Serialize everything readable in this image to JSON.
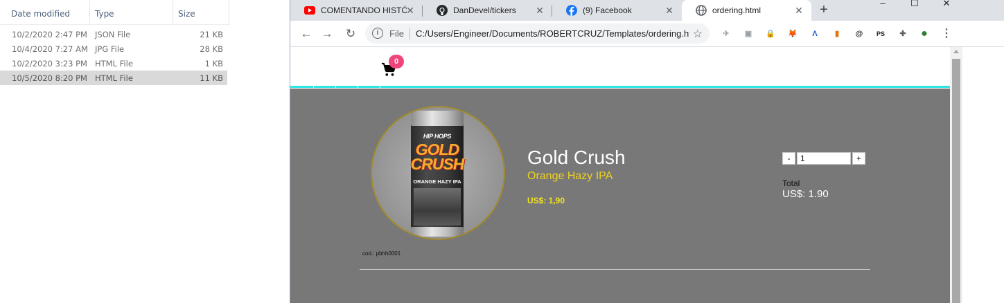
{
  "explorer": {
    "columns": {
      "date": "Date modified",
      "type": "Type",
      "size": "Size"
    },
    "rows": [
      {
        "date": "10/2/2020 2:47 PM",
        "type": "JSON File",
        "size": "21 KB"
      },
      {
        "date": "10/4/2020 7:27 AM",
        "type": "JPG File",
        "size": "28 KB"
      },
      {
        "date": "10/2/2020 3:23 PM",
        "type": "HTML File",
        "size": "1 KB"
      },
      {
        "date": "10/5/2020 8:20 PM",
        "type": "HTML File",
        "size": "11 KB",
        "selected": true
      }
    ]
  },
  "browser": {
    "tabs": [
      {
        "label": "COMENTANDO HISTÓI",
        "icon": "youtube-icon",
        "color": "#ff0000"
      },
      {
        "label": "DanDevel/tickers",
        "icon": "github-icon"
      },
      {
        "label": "(9) Facebook",
        "icon": "facebook-icon",
        "color": "#1877f2"
      },
      {
        "label": "ordering.html",
        "icon": "globe-icon",
        "active": true
      }
    ],
    "window_controls": {
      "minimize": "–",
      "maximize": "☐",
      "close": "✕"
    },
    "new_tab": "+",
    "address": {
      "scheme_label": "File",
      "url": "C:/Users/Engineer/Documents/ROBERTCRUZ/Templates/ordering.html"
    },
    "extensions": [
      {
        "icon": "pin-icon",
        "glyph": "✈"
      },
      {
        "icon": "page-icon",
        "glyph": "▣"
      },
      {
        "icon": "lock-extension-icon",
        "glyph": "🔒"
      },
      {
        "icon": "metamask-icon",
        "glyph": "🦊"
      },
      {
        "icon": "a-logo-icon",
        "glyph": "Λ"
      },
      {
        "icon": "bar-chart-icon",
        "glyph": "▮"
      },
      {
        "icon": "at-icon",
        "glyph": "@"
      },
      {
        "icon": "ps-icon",
        "glyph": "PS"
      },
      {
        "icon": "puzzle-icon",
        "glyph": "✚"
      },
      {
        "icon": "profile-avatar-icon",
        "glyph": "●"
      }
    ],
    "menu_glyph": "⋮"
  },
  "page": {
    "cart_count": "0",
    "product": {
      "name": "Gold Crush",
      "style": "Orange Hazy IPA",
      "price": "US$: 1,90",
      "code": "cod.: pbhh0001",
      "can_brand": "HIP HOPS",
      "can_name": "GOLD CRUSH",
      "can_style": "ORANGE HAZY IPA"
    },
    "quantity": {
      "minus": "-",
      "value": "1",
      "plus": "+"
    },
    "total": {
      "label": "Total",
      "value": "US$: 1.90"
    },
    "colors": {
      "accent_line": "#2de6e6",
      "badge": "#f0457a",
      "product_bg": "#787878",
      "subtitle": "#f2d21e"
    }
  }
}
